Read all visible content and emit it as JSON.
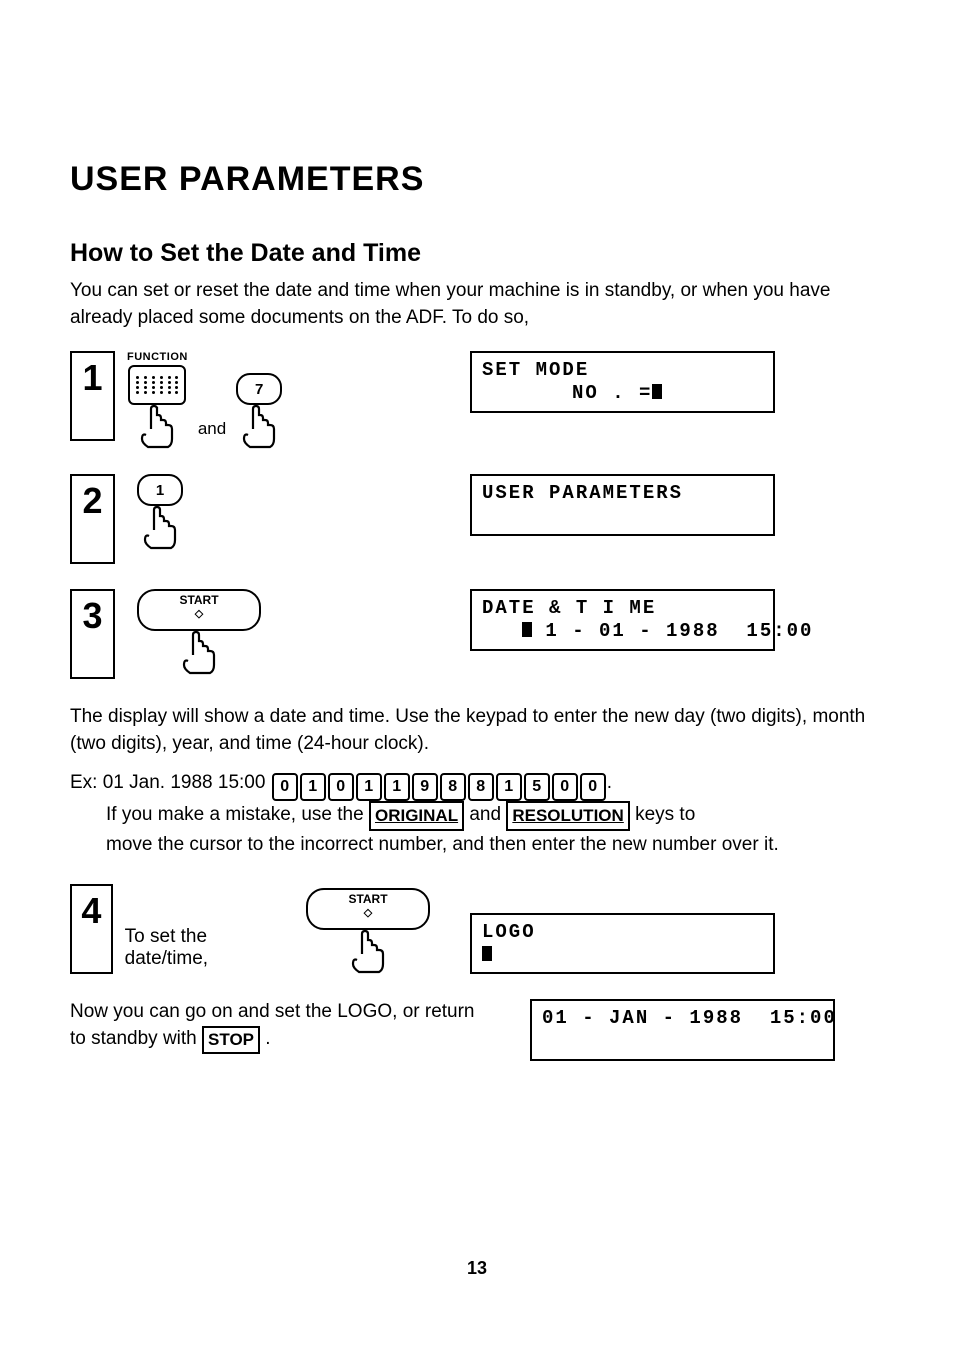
{
  "title": "USER PARAMETERS",
  "subtitle": "How to Set the Date and Time",
  "intro": "You can set or reset the date and time when your machine is in standby, or when you have already placed some documents on the ADF. To do so,",
  "steps": {
    "s1": {
      "num": "1",
      "func_label": "FUNCTION",
      "and_label": "and",
      "key7": "7",
      "lcd_l1": "SET  MODE",
      "lcd_l2": "NO . ="
    },
    "s2": {
      "num": "2",
      "key1": "1",
      "lcd_l1": "USER  PARAMETERS"
    },
    "s3": {
      "num": "3",
      "start_label": "START",
      "lcd_l1": "DATE  &  T I ME",
      "lcd_l2": " 1 - 01 - 1988  15:00"
    },
    "s4": {
      "num": "4",
      "text": "To set the date/time,",
      "start_label": "START",
      "lcd_l1": "LOGO"
    }
  },
  "para_after_3": "The display will show a date and time. Use the keypad to enter the new day (two digits), month (two digits), year, and time (24-hour clock).",
  "example": {
    "prefix": "Ex:  01 Jan. 1988 15:00 ",
    "digits": [
      "0",
      "1",
      "0",
      "1",
      "1",
      "9",
      "8",
      "8",
      "1",
      "5",
      "0",
      "0"
    ],
    "mistake_l1a": "If you make a mistake, use the ",
    "key_original": "ORIGINAL",
    "and": " and ",
    "key_resolution": "RESOLUTION",
    "mistake_l1b": " keys to",
    "mistake_l2": "move the cursor to the incorrect number, and then enter the new number over it."
  },
  "bottom": {
    "text_a": "Now you can go on and set the LOGO, or return to standby with ",
    "stop_key": "STOP",
    "text_b": " .",
    "lcd_l1": "01 - JAN - 1988  15:00"
  },
  "page_number": "13"
}
